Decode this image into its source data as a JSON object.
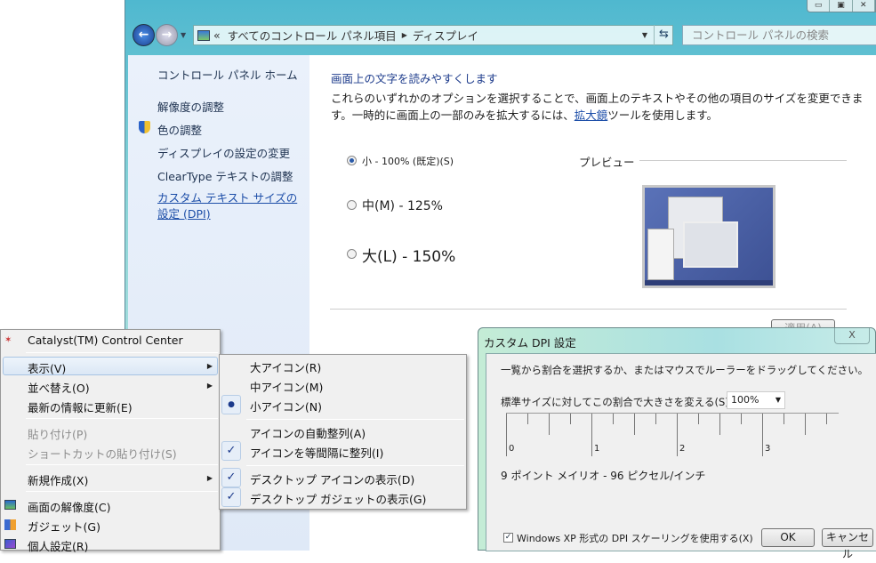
{
  "explorer": {
    "window_controls": [
      "minimize",
      "maximize",
      "close"
    ],
    "address": {
      "root_chevron": "«",
      "crumb1": "すべてのコントロール パネル項目",
      "crumb2": "ディスプレイ"
    },
    "search_placeholder": "コントロール パネルの検索",
    "sidebar": {
      "home": "コントロール パネル ホーム",
      "items": [
        "解像度の調整",
        "色の調整",
        "ディスプレイの設定の変更",
        "ClearType テキストの調整",
        "カスタム テキスト サイズの設定 (DPI)"
      ]
    },
    "main": {
      "heading": "画面上の文字を読みやすくします",
      "desc1": "これらのいずれかのオプションを選択することで、画面上のテキストやその他の項目のサイズを変更できま",
      "desc2a": "す。一時的に画面上の一部のみを拡大するには、",
      "desc2_link": "拡大鏡",
      "desc2b": "ツールを使用します。",
      "options": [
        {
          "label": "小 - 100% (既定)(S)",
          "selected": true
        },
        {
          "label": "中(M) - 125%",
          "selected": false
        },
        {
          "label": "大(L) - 150%",
          "selected": false
        }
      ],
      "preview_label": "プレビュー",
      "apply_label": "適用(A)"
    }
  },
  "context_menu": {
    "items": [
      {
        "label": "Catalyst(TM) Control Center"
      },
      {
        "label": "表示(V)"
      },
      {
        "label": "並べ替え(O)"
      },
      {
        "label": "最新の情報に更新(E)"
      },
      {
        "label": "貼り付け(P)"
      },
      {
        "label": "ショートカットの貼り付け(S)"
      },
      {
        "label": "新規作成(X)"
      },
      {
        "label": "画面の解像度(C)"
      },
      {
        "label": "ガジェット(G)"
      },
      {
        "label": "個人設定(R)"
      }
    ],
    "submenu": [
      {
        "label": "大アイコン(R)"
      },
      {
        "label": "中アイコン(M)"
      },
      {
        "label": "小アイコン(N)"
      },
      {
        "label": "アイコンの自動整列(A)"
      },
      {
        "label": "アイコンを等間隔に整列(I)"
      },
      {
        "label": "デスクトップ アイコンの表示(D)"
      },
      {
        "label": "デスクトップ ガジェットの表示(G)"
      }
    ]
  },
  "dpi_dialog": {
    "title": "カスタム DPI 設定",
    "close": "X",
    "instruction": "一覧から割合を選択するか、またはマウスでルーラーをドラッグしてください。",
    "scale_label": "標準サイズに対してこの割合で大きさを変える(S):",
    "scale_value": "100%",
    "ruler_labels": [
      "0",
      "1",
      "2",
      "3"
    ],
    "font_info": "9 ポイント メイリオ - 96 ピクセル/インチ",
    "xp_scaling_label": "Windows XP 形式の DPI スケーリングを使用する(X)",
    "xp_scaling_checked": true,
    "ok": "OK",
    "cancel": "キャンセル"
  }
}
